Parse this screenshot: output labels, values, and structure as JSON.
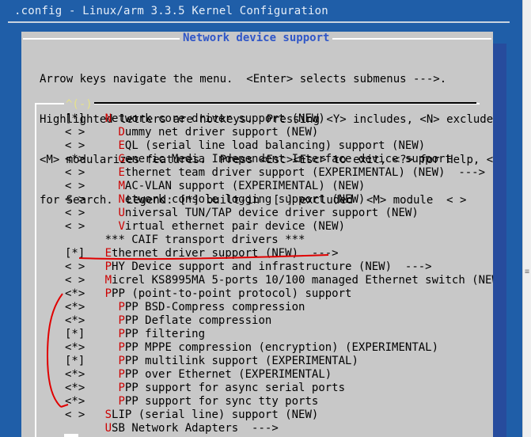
{
  "window": {
    "title": ".config - Linux/arm 3.3.5 Kernel Configuration"
  },
  "dialog": {
    "title": "Network device support",
    "help_lines": [
      "Arrow keys navigate the menu.  <Enter> selects submenus --->.",
      "Highlighted letters are hotkeys.  Pressing <Y> includes, <N> excludes,",
      "<M> modularizes features.  Press <Esc><Esc> to exit, <?> for Help, </>",
      "for Search.  Legend: [*] built-in  [ ] excluded  <M> module  < >"
    ],
    "scroll_indicator": "^(-)"
  },
  "menu": {
    "items": [
      {
        "state": "[*]",
        "indent": "   ",
        "hot": "N",
        "rest": "etwork core driver support (NEW)"
      },
      {
        "state": "< >",
        "indent": "     ",
        "hot": "D",
        "rest": "ummy net driver support (NEW)"
      },
      {
        "state": "< >",
        "indent": "     ",
        "hot": "E",
        "rest": "QL (serial line load balancing) support (NEW)"
      },
      {
        "state": "<*>",
        "indent": "     ",
        "hot": "G",
        "rest": "eneric Media Independent Interface device support"
      },
      {
        "state": "< >",
        "indent": "     ",
        "hot": "E",
        "rest": "thernet team driver support (EXPERIMENTAL) (NEW)  --->"
      },
      {
        "state": "< >",
        "indent": "     ",
        "hot": "M",
        "rest": "AC-VLAN support (EXPERIMENTAL) (NEW)"
      },
      {
        "state": "< >",
        "indent": "     ",
        "hot": "N",
        "rest": "etwork console logging support (NEW)"
      },
      {
        "state": "< >",
        "indent": "     ",
        "hot": "U",
        "rest": "niversal TUN/TAP device driver support (NEW)"
      },
      {
        "state": "< >",
        "indent": "     ",
        "hot": "V",
        "rest": "irtual ethernet pair device (NEW)"
      },
      {
        "state": "   ",
        "indent": "   ",
        "hot": "",
        "rest": "*** CAIF transport drivers ***"
      },
      {
        "state": "[*]",
        "indent": "   ",
        "hot": "E",
        "rest": "thernet driver support (NEW)  --->"
      },
      {
        "state": "< >",
        "indent": "   ",
        "hot": "P",
        "rest": "HY Device support and infrastructure (NEW)  --->"
      },
      {
        "state": "< >",
        "indent": "   ",
        "hot": "M",
        "rest": "icrel KS8995MA 5-ports 10/100 managed Ethernet switch (NEW"
      },
      {
        "state": "<*>",
        "indent": "   ",
        "hot": "P",
        "rest": "PP (point-to-point protocol) support"
      },
      {
        "state": "<*>",
        "indent": "     ",
        "hot": "P",
        "rest": "PP BSD-Compress compression"
      },
      {
        "state": "<*>",
        "indent": "     ",
        "hot": "P",
        "rest": "PP Deflate compression"
      },
      {
        "state": "[*]",
        "indent": "     ",
        "hot": "P",
        "rest": "PP filtering"
      },
      {
        "state": "<*>",
        "indent": "     ",
        "hot": "P",
        "rest": "PP MPPE compression (encryption) (EXPERIMENTAL)"
      },
      {
        "state": "[*]",
        "indent": "     ",
        "hot": "P",
        "rest": "PP multilink support (EXPERIMENTAL)"
      },
      {
        "state": "<*>",
        "indent": "     ",
        "hot": "P",
        "rest": "PP over Ethernet (EXPERIMENTAL)"
      },
      {
        "state": "<*>",
        "indent": "     ",
        "hot": "P",
        "rest": "PP support for async serial ports"
      },
      {
        "state": "<*>",
        "indent": "     ",
        "hot": "P",
        "rest": "PP support for sync tty ports"
      },
      {
        "state": "< >",
        "indent": "   ",
        "hot": "S",
        "rest": "LIP (serial line) support (NEW)"
      },
      {
        "state": "   ",
        "indent": "   ",
        "hot": "U",
        "rest": "SB Network Adapters  --->"
      }
    ]
  },
  "colors": {
    "terminal_bg": "#1f5ea8",
    "dialog_bg": "#c8c8c8",
    "title_blue": "#2f56c7",
    "hotkey": "#cc0000",
    "annotation": "#e00000"
  }
}
